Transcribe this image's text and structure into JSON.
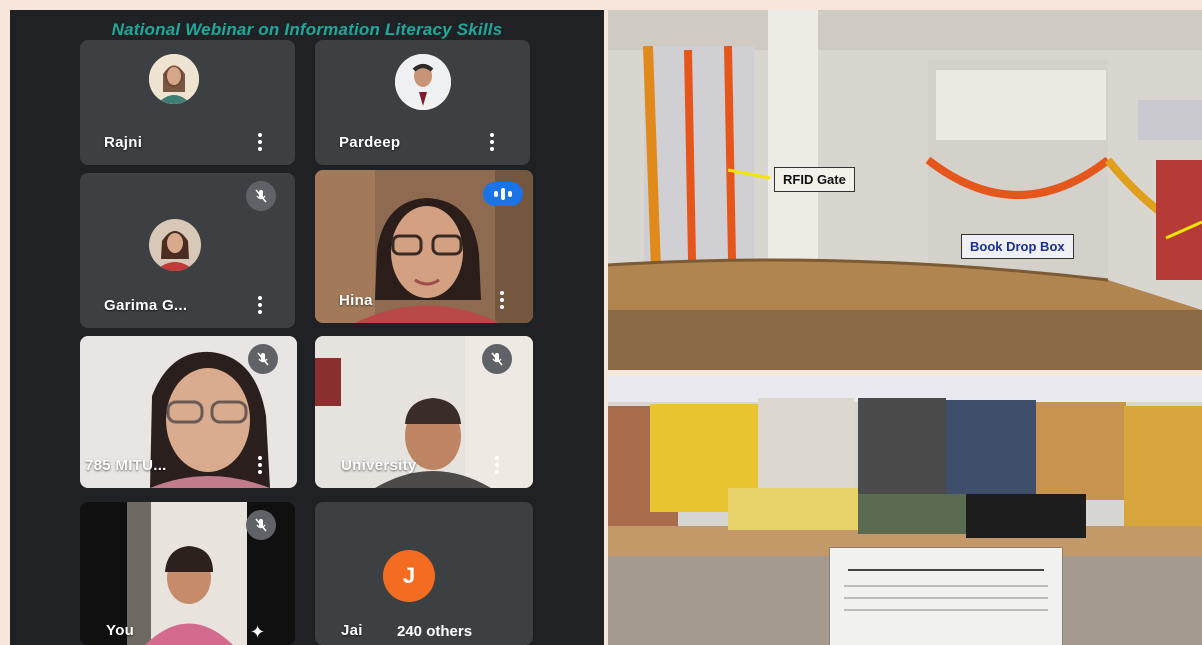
{
  "meeting": {
    "banner": "National Webinar on Information Literacy Skills",
    "participants": [
      {
        "name": "Rajni",
        "muted": false
      },
      {
        "name": "Pardeep",
        "muted": false
      },
      {
        "name": "Garima G...",
        "muted": true
      },
      {
        "name": "Hina",
        "muted": false,
        "speaking": true
      },
      {
        "name": "785 MITU...",
        "muted": true
      },
      {
        "name": "University",
        "muted": true
      },
      {
        "name": "You",
        "muted": true
      }
    ],
    "others_tile": {
      "avatar_letter": "J",
      "name": "Jai",
      "others_label": "240 others",
      "avatar_color": "#f36c21"
    },
    "accent_color": "#1fa89a",
    "speaking_color": "#1a73e8"
  },
  "library_photo": {
    "labels": {
      "rfid": "RFID Gate",
      "drop_box": "Book Drop Box"
    }
  }
}
